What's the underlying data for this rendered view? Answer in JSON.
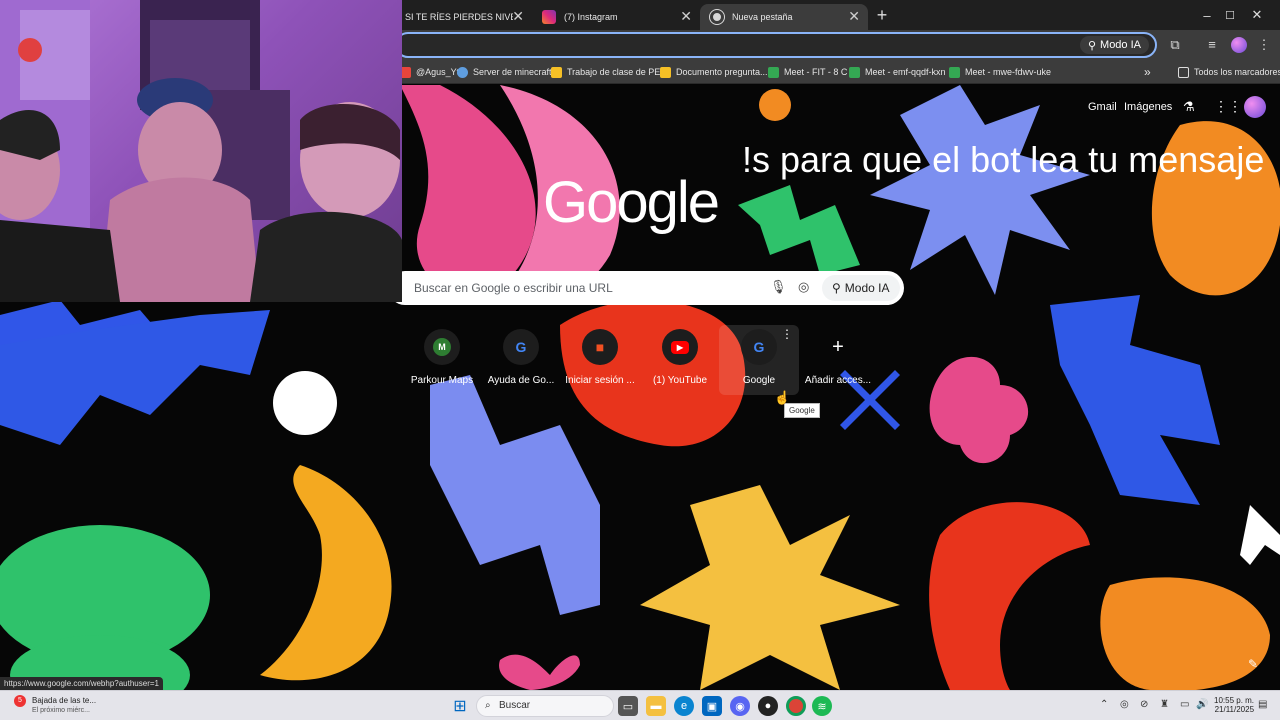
{
  "browser": {
    "tabs": [
      {
        "title": "SI TE RÍES PIERDES NIVEL DIOS",
        "favicon_color": "#c00000",
        "active": false
      },
      {
        "title": "(7) Instagram",
        "favicon_color": "#d6249f",
        "active": false
      },
      {
        "title": "Nueva pestaña",
        "favicon_color": "#cfcfcf",
        "active": true
      }
    ],
    "new_tab_symbol": "+",
    "window_controls": [
      "–",
      "☐",
      "✕"
    ],
    "omnibox": {
      "modo_ia_label": "Modo IA"
    },
    "bookmarks": [
      {
        "label": "@Agus_Yt",
        "icon_color": "#e8453c"
      },
      {
        "label": "Server de minecraft",
        "icon_color": "#5f9ee0"
      },
      {
        "label": "Trabajo de clase de PE...",
        "icon_color": "#f6c026"
      },
      {
        "label": "Documento pregunta...",
        "icon_color": "#f6c026"
      },
      {
        "label": "Meet - FIT - 8 C",
        "icon_color": "#34a853"
      },
      {
        "label": "Meet - emf-qqdf-kxn",
        "icon_color": "#34a853"
      },
      {
        "label": "Meet - mwe-fdwv-uke",
        "icon_color": "#34a853"
      }
    ],
    "bookmarks_overflow": "»",
    "all_bookmarks_label": "Todos los marcadores"
  },
  "ntp": {
    "top_links": {
      "gmail": "Gmail",
      "images": "Imágenes"
    },
    "logo_text": "Google",
    "overlay_message": "!s para que el bot lea tu mensaje",
    "search": {
      "placeholder": "Buscar en Google o escribir una URL",
      "modo_ia": "Modo IA"
    },
    "shortcuts": [
      {
        "label": "Parkour Maps",
        "glyph": "M",
        "color": "#2e7d32"
      },
      {
        "label": "Ayuda de Go...",
        "glyph": "G",
        "color": "#4285f4"
      },
      {
        "label": "Iniciar sesión ...",
        "glyph": "■",
        "color": "#f25022"
      },
      {
        "label": "(1) YouTube",
        "glyph": "▶",
        "color": "#ff0000"
      },
      {
        "label": "Google",
        "glyph": "G",
        "color": "#4285f4"
      },
      {
        "label": "Añadir acces...",
        "glyph": "+",
        "color": "#ffffff"
      }
    ],
    "tooltip": "Google",
    "status_url": "https://www.google.com/webhp?authuser=1"
  },
  "taskbar": {
    "notification_title": "Bajada de las te...",
    "notification_sub": "El próximo miérc...",
    "notification_badge": "5",
    "search_label": "Buscar",
    "time": "10:55 p. m.",
    "date": "21/11/2025"
  }
}
